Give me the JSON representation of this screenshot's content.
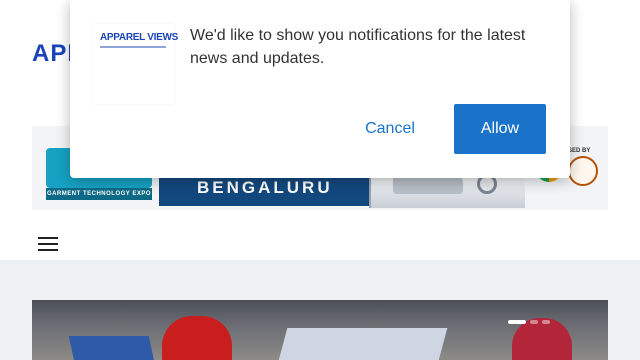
{
  "header": {
    "logo_text": "APPAREL VIEWS"
  },
  "banner": {
    "city": "BENGALURU",
    "subtitle": "GARMENT TECHNOLOGY EXPO",
    "organizer_label": "SED BY"
  },
  "notification": {
    "logo_text": "APPAREL VIEWS",
    "message": "We'd like to show you notifications for the latest news and updates.",
    "cancel_label": "Cancel",
    "allow_label": "Allow",
    "accent_color": "#1a73c8"
  },
  "nav": {
    "menu_icon": "hamburger-menu-icon"
  },
  "hero": {
    "slide_count": 3,
    "active_slide": 1
  }
}
